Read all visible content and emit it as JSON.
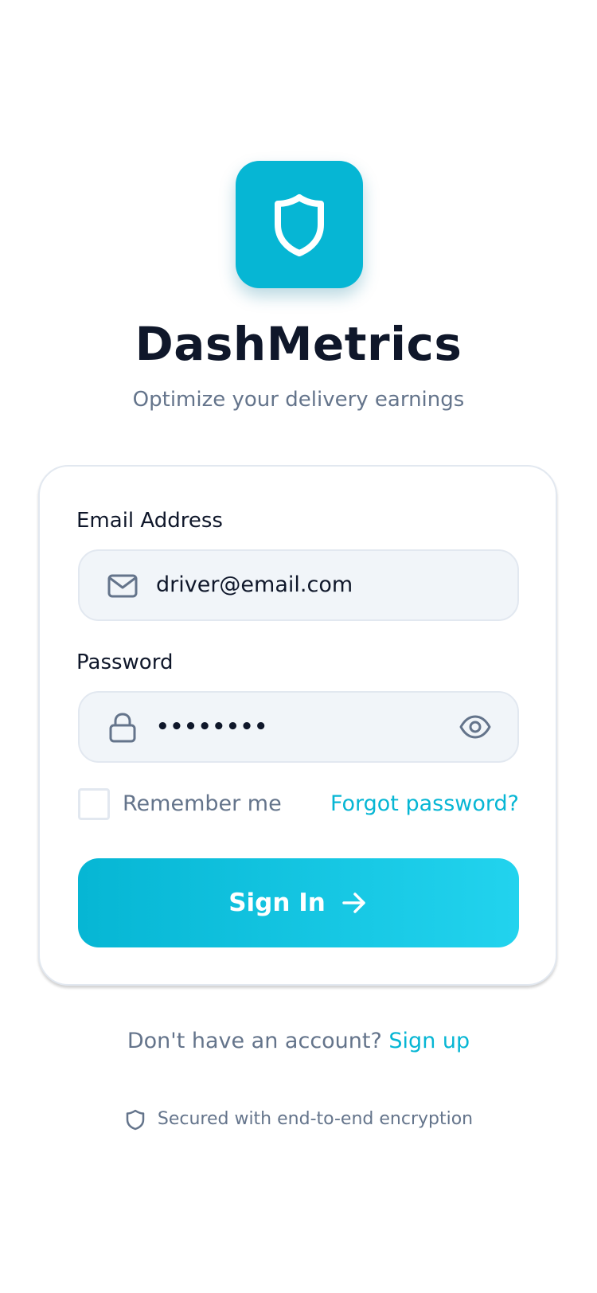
{
  "app": {
    "name": "DashMetrics",
    "tagline": "Optimize your delivery earnings",
    "logo_icon": "shield-icon",
    "accent_color": "#06b6d4"
  },
  "form": {
    "email_label": "Email Address",
    "email_value": "driver@email.com",
    "email_icon": "mail-icon",
    "password_label": "Password",
    "password_value": "••••••••",
    "password_icon": "lock-icon",
    "password_visibility_icon": "eye-icon",
    "remember_label": "Remember me",
    "remember_checked": false,
    "forgot_label": "Forgot password?",
    "submit_label": "Sign In",
    "submit_icon": "arrow-right-icon"
  },
  "footer": {
    "signup_prompt": "Don't have an account?",
    "signup_link": "Sign up",
    "security_icon": "shield-icon",
    "security_text": "Secured with end-to-end encryption"
  }
}
